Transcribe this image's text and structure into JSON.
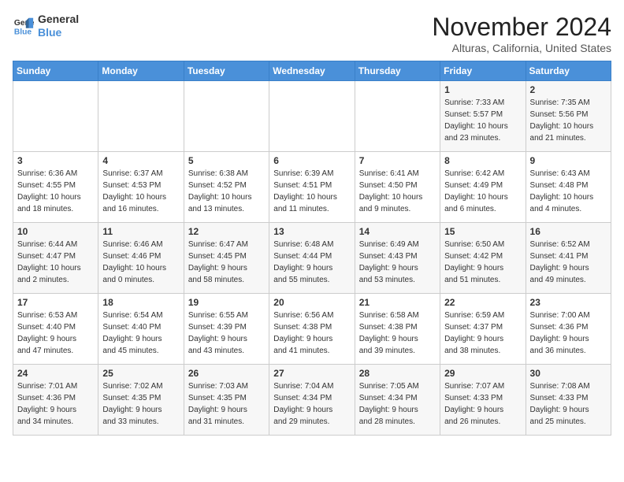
{
  "logo": {
    "line1": "General",
    "line2": "Blue"
  },
  "title": "November 2024",
  "subtitle": "Alturas, California, United States",
  "days_of_week": [
    "Sunday",
    "Monday",
    "Tuesday",
    "Wednesday",
    "Thursday",
    "Friday",
    "Saturday"
  ],
  "weeks": [
    [
      {
        "num": "",
        "info": ""
      },
      {
        "num": "",
        "info": ""
      },
      {
        "num": "",
        "info": ""
      },
      {
        "num": "",
        "info": ""
      },
      {
        "num": "",
        "info": ""
      },
      {
        "num": "1",
        "info": "Sunrise: 7:33 AM\nSunset: 5:57 PM\nDaylight: 10 hours\nand 23 minutes."
      },
      {
        "num": "2",
        "info": "Sunrise: 7:35 AM\nSunset: 5:56 PM\nDaylight: 10 hours\nand 21 minutes."
      }
    ],
    [
      {
        "num": "3",
        "info": "Sunrise: 6:36 AM\nSunset: 4:55 PM\nDaylight: 10 hours\nand 18 minutes."
      },
      {
        "num": "4",
        "info": "Sunrise: 6:37 AM\nSunset: 4:53 PM\nDaylight: 10 hours\nand 16 minutes."
      },
      {
        "num": "5",
        "info": "Sunrise: 6:38 AM\nSunset: 4:52 PM\nDaylight: 10 hours\nand 13 minutes."
      },
      {
        "num": "6",
        "info": "Sunrise: 6:39 AM\nSunset: 4:51 PM\nDaylight: 10 hours\nand 11 minutes."
      },
      {
        "num": "7",
        "info": "Sunrise: 6:41 AM\nSunset: 4:50 PM\nDaylight: 10 hours\nand 9 minutes."
      },
      {
        "num": "8",
        "info": "Sunrise: 6:42 AM\nSunset: 4:49 PM\nDaylight: 10 hours\nand 6 minutes."
      },
      {
        "num": "9",
        "info": "Sunrise: 6:43 AM\nSunset: 4:48 PM\nDaylight: 10 hours\nand 4 minutes."
      }
    ],
    [
      {
        "num": "10",
        "info": "Sunrise: 6:44 AM\nSunset: 4:47 PM\nDaylight: 10 hours\nand 2 minutes."
      },
      {
        "num": "11",
        "info": "Sunrise: 6:46 AM\nSunset: 4:46 PM\nDaylight: 10 hours\nand 0 minutes."
      },
      {
        "num": "12",
        "info": "Sunrise: 6:47 AM\nSunset: 4:45 PM\nDaylight: 9 hours\nand 58 minutes."
      },
      {
        "num": "13",
        "info": "Sunrise: 6:48 AM\nSunset: 4:44 PM\nDaylight: 9 hours\nand 55 minutes."
      },
      {
        "num": "14",
        "info": "Sunrise: 6:49 AM\nSunset: 4:43 PM\nDaylight: 9 hours\nand 53 minutes."
      },
      {
        "num": "15",
        "info": "Sunrise: 6:50 AM\nSunset: 4:42 PM\nDaylight: 9 hours\nand 51 minutes."
      },
      {
        "num": "16",
        "info": "Sunrise: 6:52 AM\nSunset: 4:41 PM\nDaylight: 9 hours\nand 49 minutes."
      }
    ],
    [
      {
        "num": "17",
        "info": "Sunrise: 6:53 AM\nSunset: 4:40 PM\nDaylight: 9 hours\nand 47 minutes."
      },
      {
        "num": "18",
        "info": "Sunrise: 6:54 AM\nSunset: 4:40 PM\nDaylight: 9 hours\nand 45 minutes."
      },
      {
        "num": "19",
        "info": "Sunrise: 6:55 AM\nSunset: 4:39 PM\nDaylight: 9 hours\nand 43 minutes."
      },
      {
        "num": "20",
        "info": "Sunrise: 6:56 AM\nSunset: 4:38 PM\nDaylight: 9 hours\nand 41 minutes."
      },
      {
        "num": "21",
        "info": "Sunrise: 6:58 AM\nSunset: 4:38 PM\nDaylight: 9 hours\nand 39 minutes."
      },
      {
        "num": "22",
        "info": "Sunrise: 6:59 AM\nSunset: 4:37 PM\nDaylight: 9 hours\nand 38 minutes."
      },
      {
        "num": "23",
        "info": "Sunrise: 7:00 AM\nSunset: 4:36 PM\nDaylight: 9 hours\nand 36 minutes."
      }
    ],
    [
      {
        "num": "24",
        "info": "Sunrise: 7:01 AM\nSunset: 4:36 PM\nDaylight: 9 hours\nand 34 minutes."
      },
      {
        "num": "25",
        "info": "Sunrise: 7:02 AM\nSunset: 4:35 PM\nDaylight: 9 hours\nand 33 minutes."
      },
      {
        "num": "26",
        "info": "Sunrise: 7:03 AM\nSunset: 4:35 PM\nDaylight: 9 hours\nand 31 minutes."
      },
      {
        "num": "27",
        "info": "Sunrise: 7:04 AM\nSunset: 4:34 PM\nDaylight: 9 hours\nand 29 minutes."
      },
      {
        "num": "28",
        "info": "Sunrise: 7:05 AM\nSunset: 4:34 PM\nDaylight: 9 hours\nand 28 minutes."
      },
      {
        "num": "29",
        "info": "Sunrise: 7:07 AM\nSunset: 4:33 PM\nDaylight: 9 hours\nand 26 minutes."
      },
      {
        "num": "30",
        "info": "Sunrise: 7:08 AM\nSunset: 4:33 PM\nDaylight: 9 hours\nand 25 minutes."
      }
    ]
  ]
}
